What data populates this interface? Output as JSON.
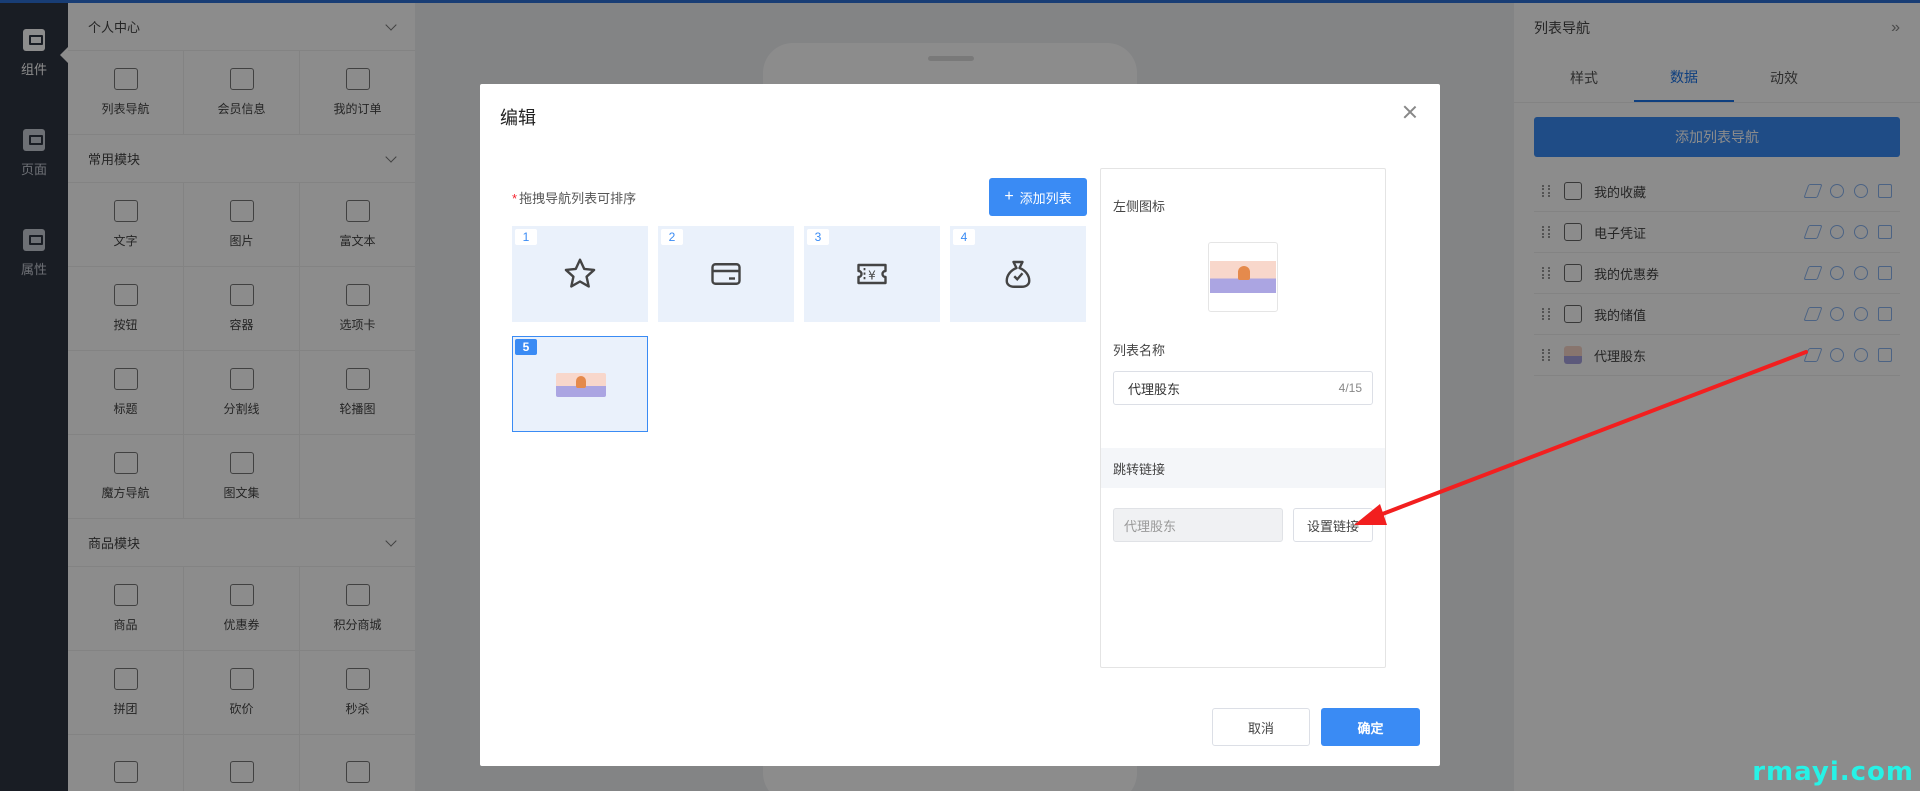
{
  "rail": {
    "items": [
      {
        "label": "组件",
        "icon": "component-icon",
        "active": true
      },
      {
        "label": "页面",
        "icon": "page-icon",
        "active": false
      },
      {
        "label": "属性",
        "icon": "property-icon",
        "active": false
      }
    ]
  },
  "components": {
    "sections": [
      {
        "title": "个人中心",
        "items": [
          "列表导航",
          "会员信息",
          "我的订单"
        ]
      },
      {
        "title": "常用模块",
        "items": [
          "文字",
          "图片",
          "富文本",
          "按钮",
          "容器",
          "选项卡",
          "标题",
          "分割线",
          "轮播图",
          "魔方导航",
          "图文集"
        ]
      },
      {
        "title": "商品模块",
        "items": [
          "商品",
          "优惠券",
          "积分商城",
          "拼团",
          "砍价",
          "秒杀",
          "",
          "",
          ""
        ]
      }
    ]
  },
  "right_panel": {
    "title": "列表导航",
    "tabs": [
      "样式",
      "数据",
      "动效"
    ],
    "active_tab": "数据",
    "add_button": "添加列表导航",
    "rows": [
      {
        "name": "我的收藏",
        "icon": "star-icon"
      },
      {
        "name": "电子凭证",
        "icon": "card-icon"
      },
      {
        "name": "我的优惠券",
        "icon": "coupon-icon"
      },
      {
        "name": "我的储值",
        "icon": "money-bag-icon"
      },
      {
        "name": "代理股东",
        "icon": "image-thumb-icon"
      }
    ]
  },
  "dialog": {
    "title": "编辑",
    "hint_required": "*",
    "hint": "拖拽导航列表可排序",
    "add_list_button": "添加列表",
    "tiles": [
      {
        "num": "1",
        "icon": "star-icon"
      },
      {
        "num": "2",
        "icon": "card-icon"
      },
      {
        "num": "3",
        "icon": "coupon-icon"
      },
      {
        "num": "4",
        "icon": "money-bag-icon"
      },
      {
        "num": "5",
        "icon": "image-thumb-icon",
        "selected": true
      }
    ],
    "form": {
      "left_icon_label": "左侧图标",
      "list_name_label": "列表名称",
      "list_name_value": "代理股东",
      "list_name_count": "4/15",
      "jump_link_label": "跳转链接",
      "jump_link_value": "代理股东",
      "set_link_button": "设置链接"
    },
    "cancel_button": "取消",
    "ok_button": "确定"
  },
  "colors": {
    "primary": "#3a8bf4",
    "arrow": "#f21f1f"
  },
  "watermark": "rmayi.com"
}
